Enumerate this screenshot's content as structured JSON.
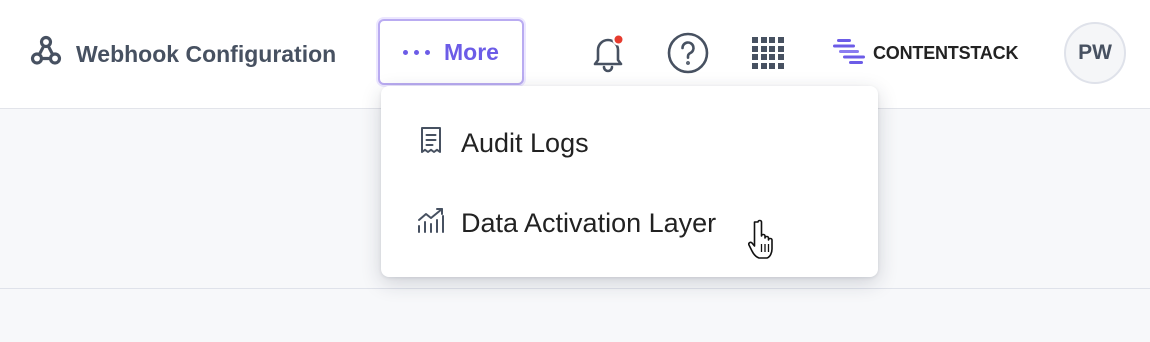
{
  "header": {
    "webhook_label": "Webhook Configuration",
    "more_label": "More",
    "brand_name": "CONTENTSTACK",
    "avatar_initials": "PW",
    "notification_has_unread": true,
    "icons": [
      "webhook-icon",
      "more-dots-icon",
      "bell-icon",
      "help-icon",
      "apps-grid-icon",
      "contentstack-logo-icon"
    ]
  },
  "more_menu": {
    "items": [
      {
        "label": "Audit Logs",
        "icon": "audit-log-icon"
      },
      {
        "label": "Data Activation Layer",
        "icon": "analytics-icon"
      }
    ]
  },
  "colors": {
    "accent": "#6c5ce7",
    "notification_dot": "#e63b2e",
    "text_dark": "#222222",
    "text_muted": "#475161"
  }
}
